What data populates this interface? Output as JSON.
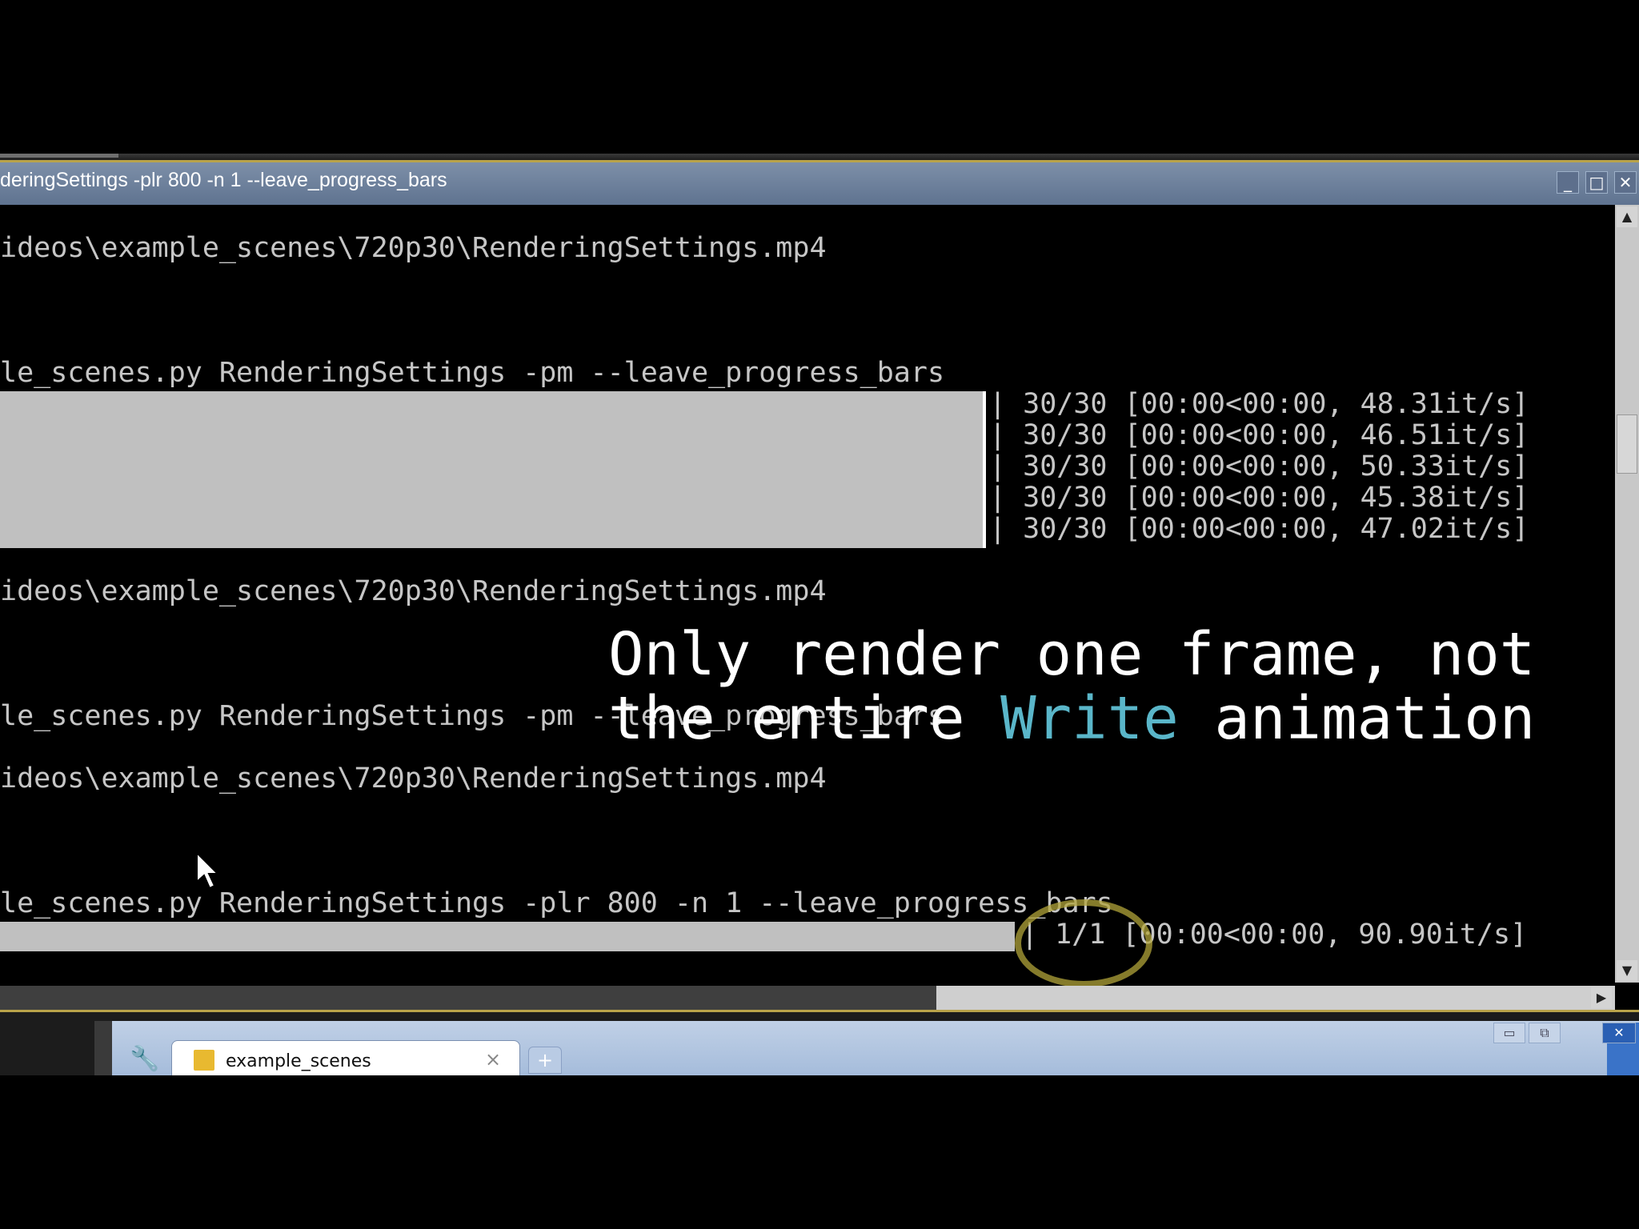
{
  "window": {
    "title": "deringSettings -plr 800 -n 1 --leave_progress_bars",
    "minimize_glyph": "_",
    "maximize_glyph": "□",
    "close_glyph": "✕"
  },
  "console": {
    "lines": [
      "ideos\\example_scenes\\720p30\\RenderingSettings.mp4",
      "le_scenes.py RenderingSettings -pm --leave_progress_bars",
      "| 30/30 [00:00<00:00, 48.31it/s]",
      "| 30/30 [00:00<00:00, 46.51it/s]",
      "| 30/30 [00:00<00:00, 50.33it/s]",
      "| 30/30 [00:00<00:00, 45.38it/s]",
      "| 30/30 [00:00<00:00, 47.02it/s]",
      "ideos\\example_scenes\\720p30\\RenderingSettings.mp4",
      "le_scenes.py RenderingSettings -pm --leave_progress_bars",
      "ideos\\example_scenes\\720p30\\RenderingSettings.mp4",
      "le_scenes.py RenderingSettings -plr 800 -n 1 --leave_progress_bars",
      "| 1/1 [00:00<00:00, 90.90it/s]"
    ],
    "progress_bars": [
      {
        "label": "30/30",
        "fraction": 1.0
      },
      {
        "label": "1/1",
        "fraction": 1.0
      }
    ]
  },
  "caption": {
    "line1": "Only render one frame, not",
    "line2_pre": "the entire ",
    "line2_highlight": "Write",
    "line2_post": " animation",
    "highlight_color": "#5ab6c9"
  },
  "scrollbars": {
    "up_arrow": "▲",
    "down_arrow": "▼",
    "right_arrow": "▶"
  },
  "taskbar": {
    "wrench_icon": "🔧",
    "tab_label": "example_scenes",
    "tab_close": "×",
    "new_tab": "+",
    "btn_minimize": "▭",
    "btn_restore": "⧉",
    "btn_close": "✕"
  }
}
